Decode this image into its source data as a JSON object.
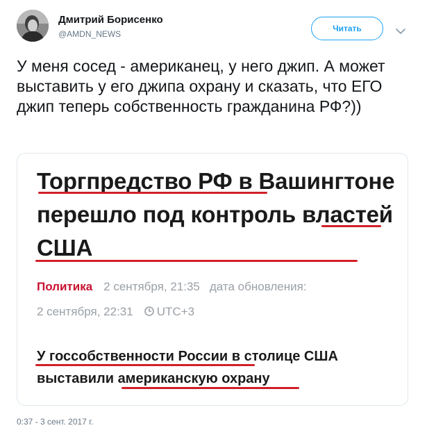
{
  "author": {
    "name": "Дмитрий Борисенко",
    "handle": "@AMDN_NEWS"
  },
  "follow_label": "Читать",
  "tweet_text": "У меня сосед - американец, у него джип. А может выставить у его джипа охрану и сказать, что ЕГО джип теперь собственность гражданина РФ?))",
  "card": {
    "headline": "Торгпредство РФ в Вашингтоне перешло под контроль властей США",
    "category": "Политика",
    "date": "2 сентября, 21:35",
    "updated_label": "дата обновления:",
    "updated_date": "2 сентября, 22:31",
    "timezone": "UTC+3",
    "lead": "У госсобственности России в столице США выставили американскую охрану"
  },
  "timestamp": "0:37 - 3 сент. 2017 г.",
  "colors": {
    "accent": "#1da1f2",
    "underline": "#d21f27",
    "category": "#c8102e"
  }
}
